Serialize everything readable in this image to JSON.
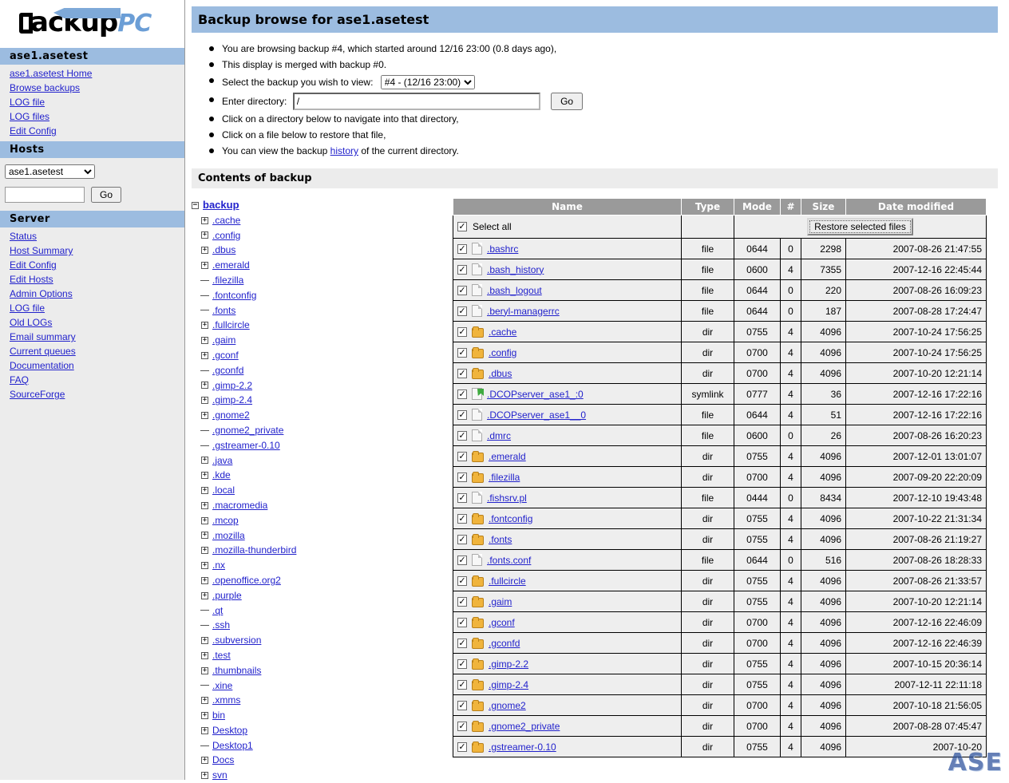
{
  "brand": {
    "name_main": "ackup",
    "name_accent": "PC"
  },
  "sidebar": {
    "host_header": "ase1.asetest",
    "host_links": [
      "ase1.asetest Home",
      "Browse backups",
      "LOG file",
      "LOG files",
      "Edit Config"
    ],
    "hosts_header": "Hosts",
    "host_select_value": "ase1.asetest",
    "host_search_value": "",
    "host_go_label": "Go",
    "server_header": "Server",
    "server_links": [
      "Status",
      "Host Summary",
      "Edit Config",
      "Edit Hosts",
      "Admin Options",
      "LOG file",
      "Old LOGs",
      "Email summary",
      "Current queues",
      "Documentation",
      "FAQ",
      "SourceForge"
    ]
  },
  "main": {
    "title": "Backup browse for ase1.asetest",
    "notes": {
      "line1": "You are browsing backup #4, which started around 12/16 23:00 (0.8 days ago),",
      "line2": "This display is merged with backup #0.",
      "line3_label": "Select the backup you wish to view:",
      "line3_value": "#4 - (12/16 23:00)",
      "line4_label": "Enter directory:",
      "line4_value": "/",
      "line4_button": "Go",
      "line5": "Click on a directory below to navigate into that directory,",
      "line6": "Click on a file below to restore that file,",
      "line7_pre": "You can view the backup ",
      "line7_link": "history",
      "line7_post": " of the current directory."
    },
    "contents_header": "Contents of backup"
  },
  "tree": {
    "root": "backup",
    "nodes": [
      {
        "label": ".cache",
        "expandable": true
      },
      {
        "label": ".config",
        "expandable": true
      },
      {
        "label": ".dbus",
        "expandable": true
      },
      {
        "label": ".emerald",
        "expandable": true
      },
      {
        "label": ".filezilla",
        "expandable": false
      },
      {
        "label": ".fontconfig",
        "expandable": false
      },
      {
        "label": ".fonts",
        "expandable": false
      },
      {
        "label": ".fullcircle",
        "expandable": true
      },
      {
        "label": ".gaim",
        "expandable": true
      },
      {
        "label": ".gconf",
        "expandable": true
      },
      {
        "label": ".gconfd",
        "expandable": false
      },
      {
        "label": ".gimp-2.2",
        "expandable": true
      },
      {
        "label": ".gimp-2.4",
        "expandable": true
      },
      {
        "label": ".gnome2",
        "expandable": true
      },
      {
        "label": ".gnome2_private",
        "expandable": false
      },
      {
        "label": ".gstreamer-0.10",
        "expandable": false
      },
      {
        "label": ".java",
        "expandable": true
      },
      {
        "label": ".kde",
        "expandable": true
      },
      {
        "label": ".local",
        "expandable": true
      },
      {
        "label": ".macromedia",
        "expandable": true
      },
      {
        "label": ".mcop",
        "expandable": true
      },
      {
        "label": ".mozilla",
        "expandable": true
      },
      {
        "label": ".mozilla-thunderbird",
        "expandable": true
      },
      {
        "label": ".nx",
        "expandable": true
      },
      {
        "label": ".openoffice.org2",
        "expandable": true
      },
      {
        "label": ".purple",
        "expandable": true
      },
      {
        "label": ".qt",
        "expandable": false
      },
      {
        "label": ".ssh",
        "expandable": false
      },
      {
        "label": ".subversion",
        "expandable": true
      },
      {
        "label": ".test",
        "expandable": true
      },
      {
        "label": ".thumbnails",
        "expandable": true
      },
      {
        "label": ".xine",
        "expandable": false
      },
      {
        "label": ".xmms",
        "expandable": true
      },
      {
        "label": "bin",
        "expandable": true
      },
      {
        "label": "Desktop",
        "expandable": true
      },
      {
        "label": "Desktop1",
        "expandable": false
      },
      {
        "label": "Docs",
        "expandable": true
      },
      {
        "label": "svn",
        "expandable": true
      }
    ]
  },
  "table": {
    "columns": [
      "Name",
      "Type",
      "Mode",
      "#",
      "Size",
      "Date modified"
    ],
    "select_all_label": "Select all",
    "restore_button": "Restore selected files",
    "rows": [
      {
        "name": ".bashrc",
        "icon": "file",
        "type": "file",
        "mode": "0644",
        "num": "0",
        "size": "2298",
        "date": "2007-08-26 21:47:55"
      },
      {
        "name": ".bash_history",
        "icon": "file",
        "type": "file",
        "mode": "0600",
        "num": "4",
        "size": "7355",
        "date": "2007-12-16 22:45:44"
      },
      {
        "name": ".bash_logout",
        "icon": "file",
        "type": "file",
        "mode": "0644",
        "num": "0",
        "size": "220",
        "date": "2007-08-26 16:09:23"
      },
      {
        "name": ".beryl-managerrc",
        "icon": "file",
        "type": "file",
        "mode": "0644",
        "num": "0",
        "size": "187",
        "date": "2007-08-28 17:24:47"
      },
      {
        "name": ".cache",
        "icon": "dir",
        "type": "dir",
        "mode": "0755",
        "num": "4",
        "size": "4096",
        "date": "2007-10-24 17:56:25"
      },
      {
        "name": ".config",
        "icon": "dir",
        "type": "dir",
        "mode": "0700",
        "num": "4",
        "size": "4096",
        "date": "2007-10-24 17:56:25"
      },
      {
        "name": ".dbus",
        "icon": "dir",
        "type": "dir",
        "mode": "0700",
        "num": "4",
        "size": "4096",
        "date": "2007-10-20 12:21:14"
      },
      {
        "name": ".DCOPserver_ase1_:0",
        "icon": "link",
        "type": "symlink",
        "mode": "0777",
        "num": "4",
        "size": "36",
        "date": "2007-12-16 17:22:16"
      },
      {
        "name": ".DCOPserver_ase1__0",
        "icon": "file",
        "type": "file",
        "mode": "0644",
        "num": "4",
        "size": "51",
        "date": "2007-12-16 17:22:16"
      },
      {
        "name": ".dmrc",
        "icon": "file",
        "type": "file",
        "mode": "0600",
        "num": "0",
        "size": "26",
        "date": "2007-08-26 16:20:23"
      },
      {
        "name": ".emerald",
        "icon": "dir",
        "type": "dir",
        "mode": "0755",
        "num": "4",
        "size": "4096",
        "date": "2007-12-01 13:01:07"
      },
      {
        "name": ".filezilla",
        "icon": "dir",
        "type": "dir",
        "mode": "0700",
        "num": "4",
        "size": "4096",
        "date": "2007-09-20 22:20:09"
      },
      {
        "name": ".fishsrv.pl",
        "icon": "file",
        "type": "file",
        "mode": "0444",
        "num": "0",
        "size": "8434",
        "date": "2007-12-10 19:43:48"
      },
      {
        "name": ".fontconfig",
        "icon": "dir",
        "type": "dir",
        "mode": "0755",
        "num": "4",
        "size": "4096",
        "date": "2007-10-22 21:31:34"
      },
      {
        "name": ".fonts",
        "icon": "dir",
        "type": "dir",
        "mode": "0755",
        "num": "4",
        "size": "4096",
        "date": "2007-08-26 21:19:27"
      },
      {
        "name": ".fonts.conf",
        "icon": "file",
        "type": "file",
        "mode": "0644",
        "num": "0",
        "size": "516",
        "date": "2007-08-26 18:28:33"
      },
      {
        "name": ".fullcircle",
        "icon": "dir",
        "type": "dir",
        "mode": "0755",
        "num": "4",
        "size": "4096",
        "date": "2007-08-26 21:33:57"
      },
      {
        "name": ".gaim",
        "icon": "dir",
        "type": "dir",
        "mode": "0755",
        "num": "4",
        "size": "4096",
        "date": "2007-10-20 12:21:14"
      },
      {
        "name": ".gconf",
        "icon": "dir",
        "type": "dir",
        "mode": "0700",
        "num": "4",
        "size": "4096",
        "date": "2007-12-16 22:46:09"
      },
      {
        "name": ".gconfd",
        "icon": "dir",
        "type": "dir",
        "mode": "0700",
        "num": "4",
        "size": "4096",
        "date": "2007-12-16 22:46:39"
      },
      {
        "name": ".gimp-2.2",
        "icon": "dir",
        "type": "dir",
        "mode": "0755",
        "num": "4",
        "size": "4096",
        "date": "2007-10-15 20:36:14"
      },
      {
        "name": ".gimp-2.4",
        "icon": "dir",
        "type": "dir",
        "mode": "0755",
        "num": "4",
        "size": "4096",
        "date": "2007-12-11 22:11:18"
      },
      {
        "name": ".gnome2",
        "icon": "dir",
        "type": "dir",
        "mode": "0700",
        "num": "4",
        "size": "4096",
        "date": "2007-10-18 21:56:05"
      },
      {
        "name": ".gnome2_private",
        "icon": "dir",
        "type": "dir",
        "mode": "0700",
        "num": "4",
        "size": "4096",
        "date": "2007-08-28 07:45:47"
      },
      {
        "name": ".gstreamer-0.10",
        "icon": "dir",
        "type": "dir",
        "mode": "0755",
        "num": "4",
        "size": "4096",
        "date": "2007-10-20"
      }
    ]
  },
  "watermark": "ASE"
}
